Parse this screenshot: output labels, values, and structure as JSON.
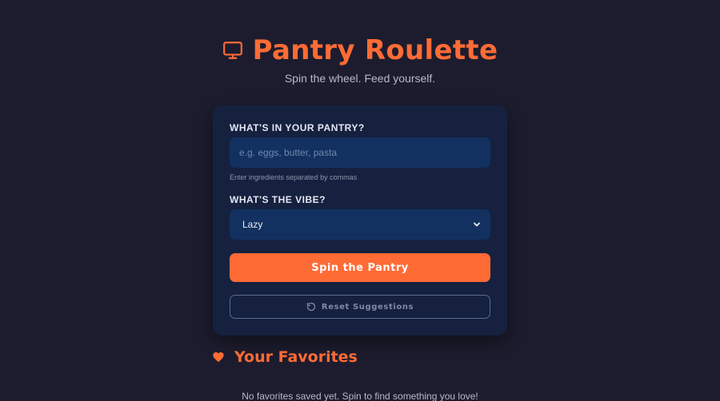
{
  "header": {
    "title": "Pantry Roulette",
    "title_icon": "monitor-icon",
    "subtitle": "Spin the wheel. Feed yourself."
  },
  "form": {
    "pantry_label": "WHAT'S IN YOUR PANTRY?",
    "pantry_value": "",
    "pantry_placeholder": "e.g. eggs, butter, pasta",
    "pantry_helper": "Enter ingredients separated by commas",
    "vibe_label": "WHAT'S THE VIBE?",
    "vibe_selected": "Lazy",
    "spin_label": "Spin the Pantry",
    "reset_label": "Reset Suggestions",
    "reset_icon": "refresh-icon"
  },
  "favorites": {
    "heading": "Your Favorites",
    "heading_icon": "heart-icon",
    "empty_message": "No favorites saved yet. Spin to find something you love!"
  },
  "colors": {
    "background": "#1d1c2e",
    "card": "#15213f",
    "input": "#123160",
    "accent": "#ff6b35"
  }
}
